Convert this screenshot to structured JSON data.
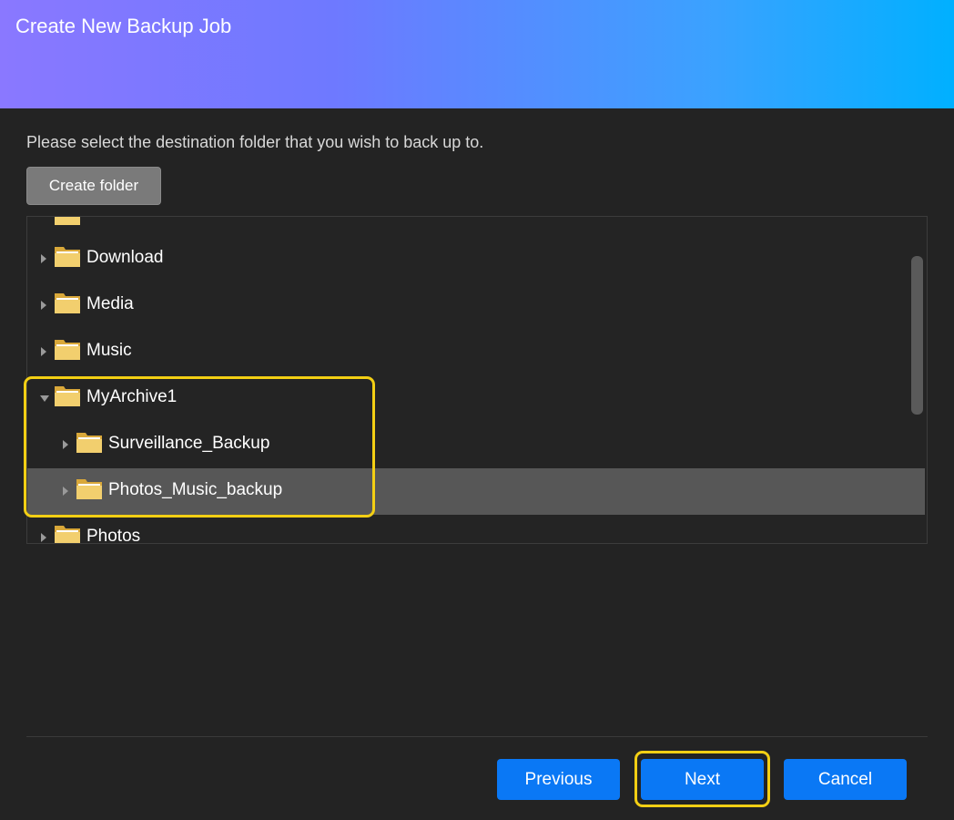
{
  "dialog": {
    "title": "Create New Backup Job",
    "instruction": "Please select the destination folder that you wish to back up to.",
    "create_folder_label": "Create folder"
  },
  "tree": {
    "items": [
      {
        "label": "",
        "expanded": false,
        "level": 0,
        "partial": "top"
      },
      {
        "label": "Download",
        "expanded": false,
        "level": 0
      },
      {
        "label": "Media",
        "expanded": false,
        "level": 0
      },
      {
        "label": "Music",
        "expanded": false,
        "level": 0
      },
      {
        "label": "MyArchive1",
        "expanded": true,
        "level": 0
      },
      {
        "label": "Surveillance_Backup",
        "expanded": false,
        "level": 1
      },
      {
        "label": "Photos_Music_backup",
        "expanded": false,
        "level": 1,
        "selected": true
      },
      {
        "label": "Photos",
        "expanded": false,
        "level": 0,
        "partial": "bottom"
      }
    ]
  },
  "footer": {
    "previous_label": "Previous",
    "next_label": "Next",
    "cancel_label": "Cancel"
  },
  "colors": {
    "primary_button": "#0a78f5",
    "highlight": "#f3cf14",
    "folder": "#f0c860"
  }
}
